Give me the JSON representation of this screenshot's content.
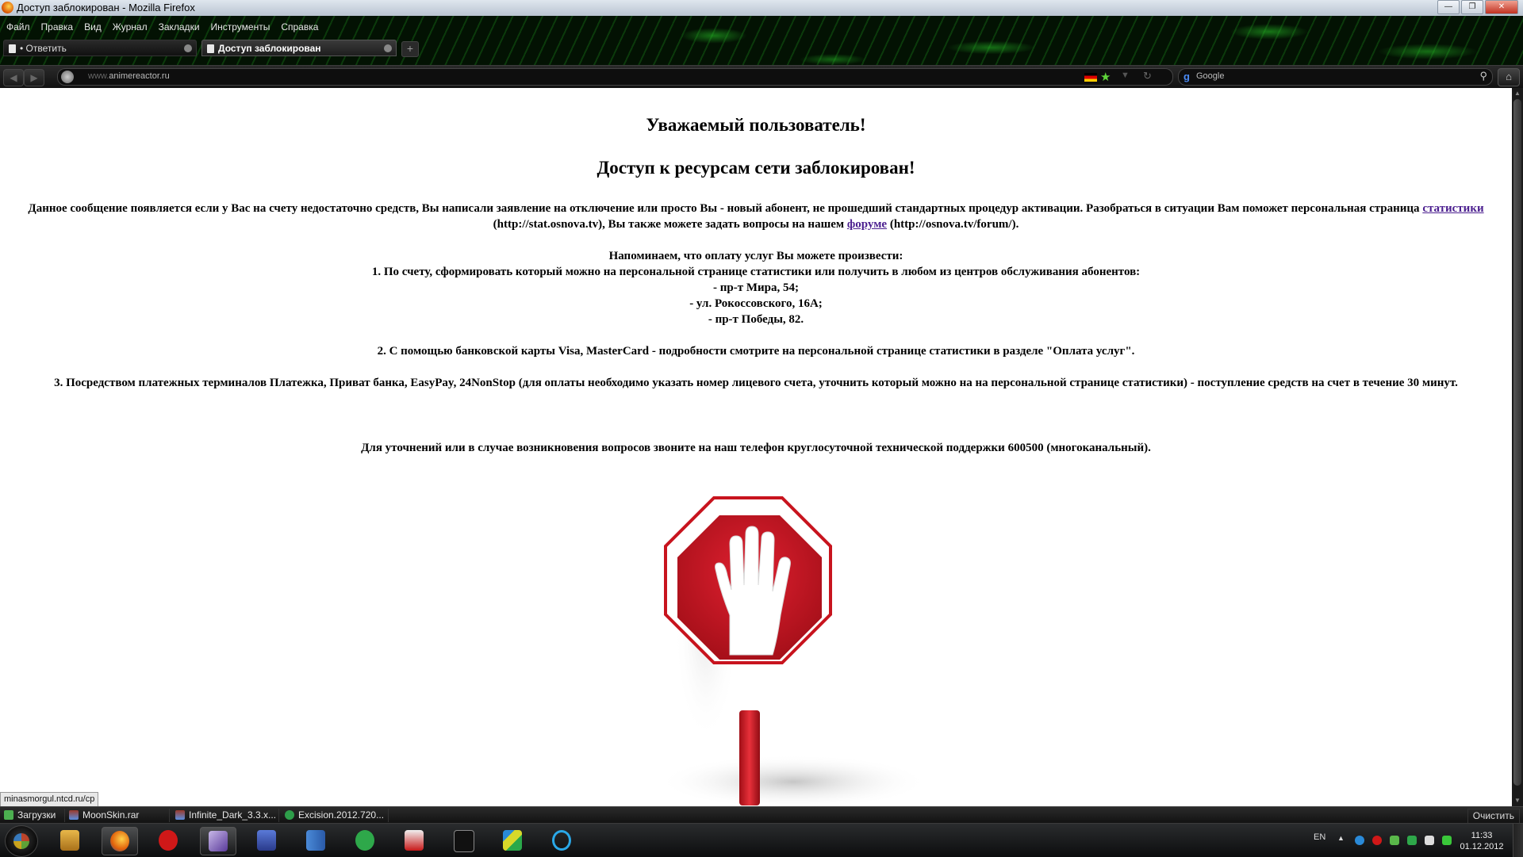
{
  "window": {
    "title": "Доступ заблокирован - Mozilla Firefox"
  },
  "menu": [
    "Файл",
    "Правка",
    "Вид",
    "Журнал",
    "Закладки",
    "Инструменты",
    "Справка"
  ],
  "tabs": [
    {
      "label": "• Ответить",
      "active": false
    },
    {
      "label": "Доступ заблокирован",
      "active": true
    }
  ],
  "navbar": {
    "url_prefix": "www.",
    "url": "animereactor.ru",
    "search_placeholder": "Google"
  },
  "page": {
    "heading1": "Уважаемый пользователь!",
    "heading2": "Доступ к ресурсам сети заблокирован!",
    "intro_part1": "Данное сообщение появляется если у Вас на счету недостаточно средств, Вы написали заявление на отключение или просто Вы - новый абонент, не прошедший стандартных процедур активации. Разобраться в ситуации Вам поможет персональная страница ",
    "intro_link1": "статистики",
    "intro_part2": " (http://stat.osnova.tv), Вы также можете задать вопросы на нашем ",
    "intro_link2": "форуме",
    "intro_part3": " (http://osnova.tv/forum/).",
    "reminder": "Напоминаем, что оплату услуг Вы можете произвести:",
    "option1": "1. По счету, сформировать который можно на персональной странице статистики или получить в любом из центров обслуживания абонентов:",
    "addresses": [
      "- пр-т Мира, 54;",
      "- ул. Рокоссовского, 16А;",
      "- пр-т Победы, 82."
    ],
    "option2": "2. С помощью банковской карты Visa, MasterCard - подробности смотрите на персональной странице статистики в разделе \"Оплата услуг\".",
    "option3": "3. Посредством платежных терминалов Платежка, Приват банка, EasyPay, 24NonStop (для оплаты необходимо указать номер лицевого счета, уточнить который можно на на персональной странице статистики) - поступление средств на счет в течение 30 минут.",
    "support": "Для уточнений или в случае возникновения вопросов звоните на наш телефон круглосуточной технической поддержки 600500 (многоканальный)."
  },
  "status_tooltip": "minasmorgul.ntcd.ru/cp",
  "downloads": {
    "items": [
      "Загрузки",
      "MoonSkin.rar",
      "Infinite_Dark_3.3.x...",
      "Excision.2012.720..."
    ],
    "clear_label": "Очистить"
  },
  "taskbar": {
    "apps": [
      "explorer-icon",
      "firefox-icon",
      "comodo-icon",
      "visual-studio-icon",
      "save-disk-icon",
      "servers-icon",
      "utorrent-icon",
      "malwarebytes-icon",
      "cmd-icon",
      "gradient-app-icon",
      "ccleaner-icon"
    ],
    "lang": "EN",
    "time": "11:33",
    "date": "01.12.2012"
  },
  "colors": {
    "link": "#4b1f8f",
    "stop_red": "#c8141e",
    "chrome_green": "#2ecc40"
  }
}
